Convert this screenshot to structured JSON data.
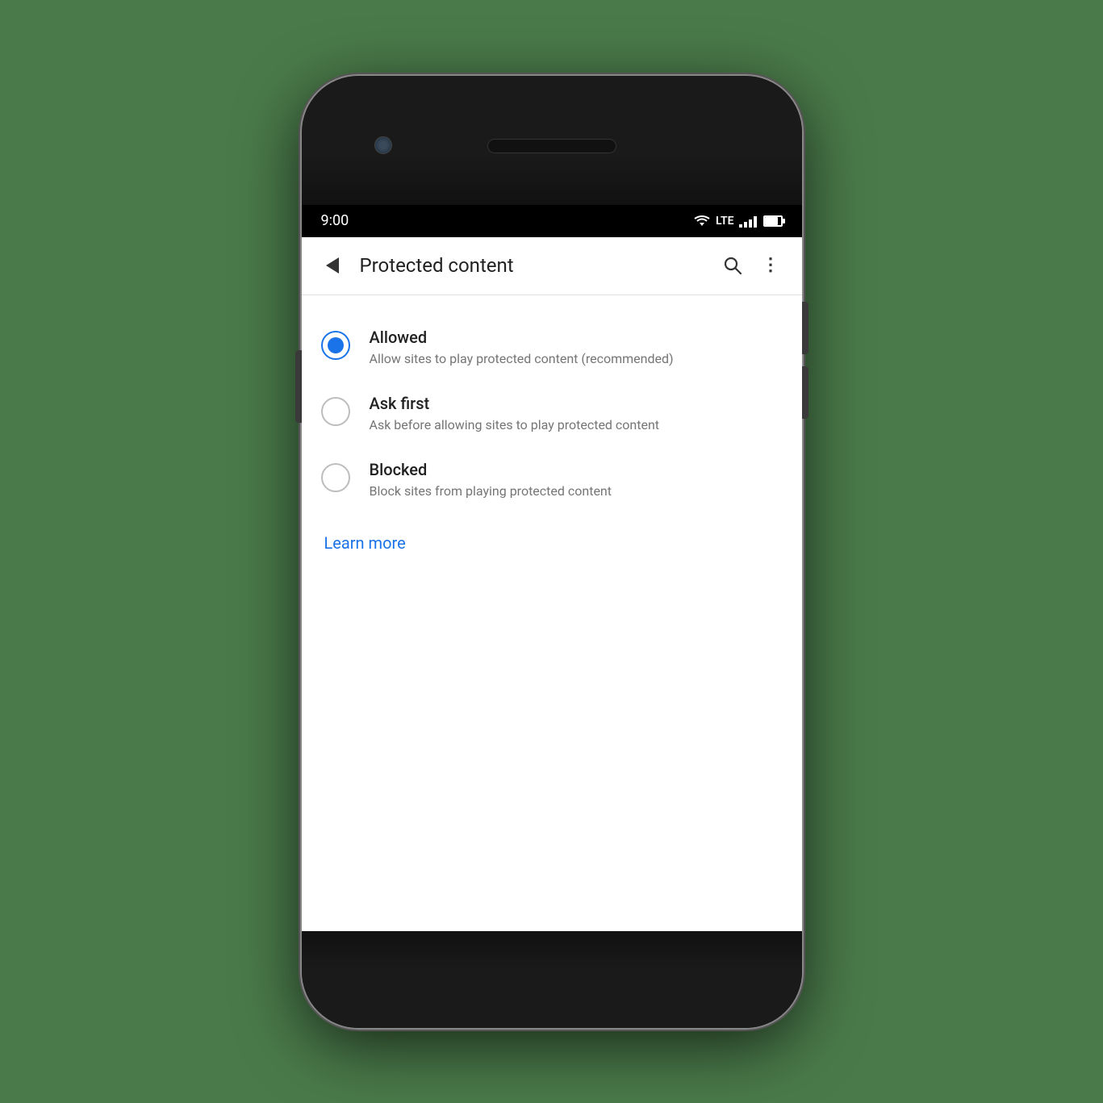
{
  "status_bar": {
    "time": "9:00",
    "lte_label": "LTE"
  },
  "app_bar": {
    "title": "Protected content",
    "back_label": "Back",
    "search_label": "Search",
    "more_label": "More options"
  },
  "options": [
    {
      "id": "allowed",
      "title": "Allowed",
      "description": "Allow sites to play protected content (recommended)",
      "selected": true
    },
    {
      "id": "ask_first",
      "title": "Ask first",
      "description": "Ask before allowing sites to play protected content",
      "selected": false
    },
    {
      "id": "blocked",
      "title": "Blocked",
      "description": "Block sites from playing protected content",
      "selected": false
    }
  ],
  "learn_more": {
    "label": "Learn more"
  },
  "colors": {
    "accent": "#1a73e8",
    "text_primary": "#212121",
    "text_secondary": "#757575"
  }
}
